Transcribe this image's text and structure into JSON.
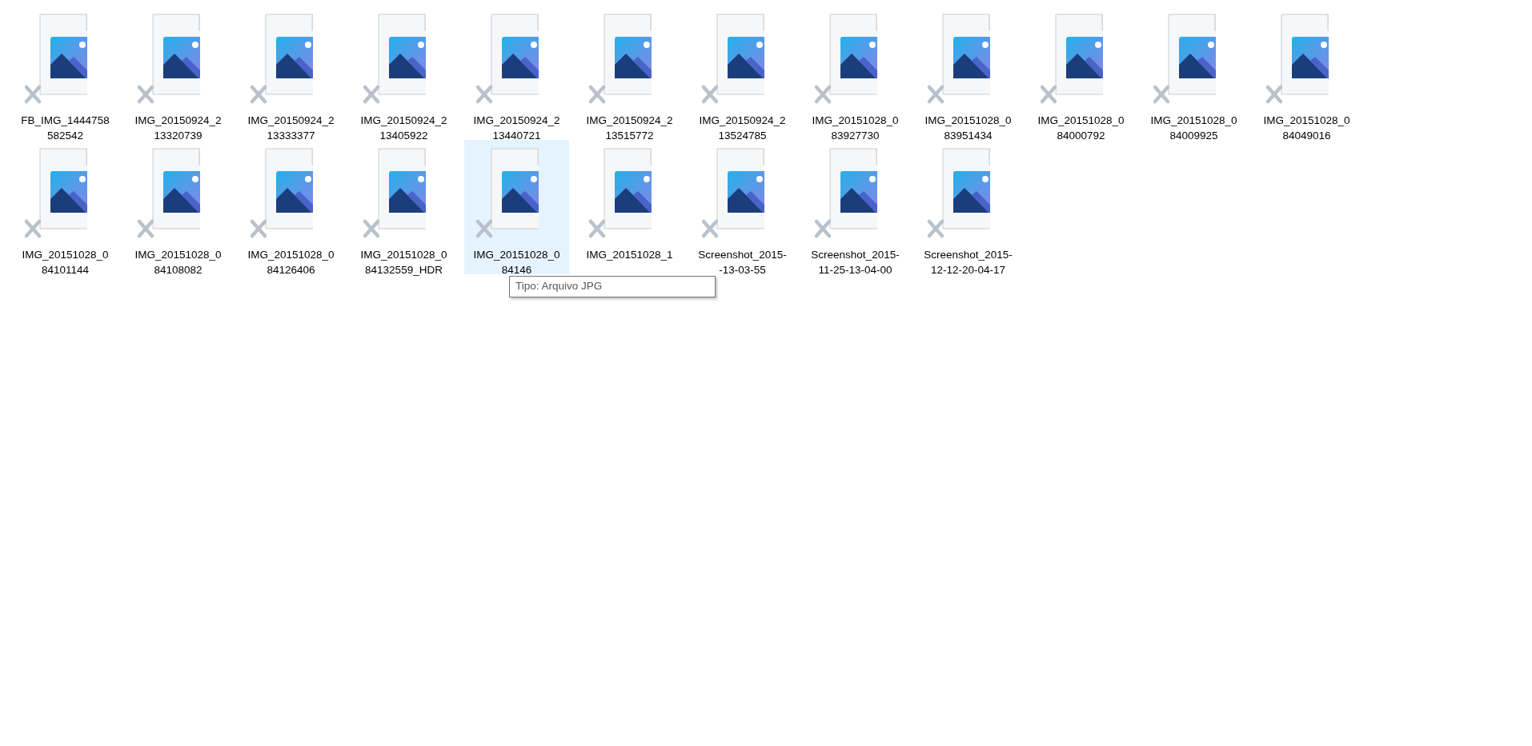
{
  "files": [
    {
      "label": [
        "FB_IMG_1444758",
        "582542"
      ],
      "selected": false
    },
    {
      "label": [
        "IMG_20150924_2",
        "13320739"
      ],
      "selected": false
    },
    {
      "label": [
        "IMG_20150924_2",
        "13333377"
      ],
      "selected": false
    },
    {
      "label": [
        "IMG_20150924_2",
        "13405922"
      ],
      "selected": false
    },
    {
      "label": [
        "IMG_20150924_2",
        "13440721"
      ],
      "selected": false
    },
    {
      "label": [
        "IMG_20150924_2",
        "13515772"
      ],
      "selected": false
    },
    {
      "label": [
        "IMG_20150924_2",
        "13524785"
      ],
      "selected": false
    },
    {
      "label": [
        "IMG_20151028_0",
        "83927730"
      ],
      "selected": false
    },
    {
      "label": [
        "IMG_20151028_0",
        "83951434"
      ],
      "selected": false
    },
    {
      "label": [
        "IMG_20151028_0",
        "84000792"
      ],
      "selected": false
    },
    {
      "label": [
        "IMG_20151028_0",
        "84009925"
      ],
      "selected": false
    },
    {
      "label": [
        "IMG_20151028_0",
        "84049016"
      ],
      "selected": false
    },
    {
      "label": [
        "IMG_20151028_0",
        "84101144"
      ],
      "selected": false
    },
    {
      "label": [
        "IMG_20151028_0",
        "84108082"
      ],
      "selected": false
    },
    {
      "label": [
        "IMG_20151028_0",
        "84126406"
      ],
      "selected": false
    },
    {
      "label": [
        "IMG_20151028_0",
        "84132559_HDR"
      ],
      "selected": false
    },
    {
      "label": [
        "IMG_20151028_0",
        "84146"
      ],
      "selected": true
    },
    {
      "label": [
        "IMG_20151028_1"
      ],
      "selected": false
    },
    {
      "label": [
        "Screenshot_2015-",
        "-13-03-55"
      ],
      "selected": false
    },
    {
      "label": [
        "Screenshot_2015-",
        "11-25-13-04-00"
      ],
      "selected": false
    },
    {
      "label": [
        "Screenshot_2015-",
        "12-12-20-04-17"
      ],
      "selected": false
    }
  ],
  "tooltip": {
    "text": "Tipo: Arquivo JPG"
  }
}
